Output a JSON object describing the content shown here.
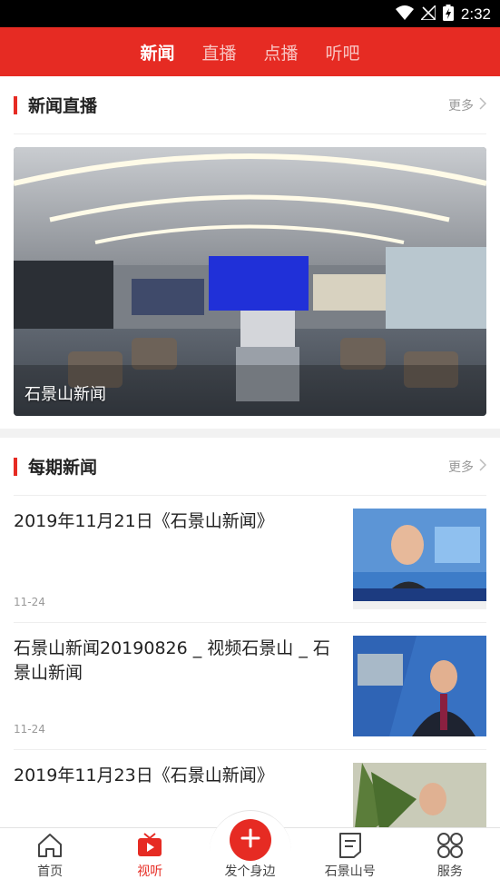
{
  "status_bar": {
    "time": "2:32",
    "icons": [
      "wifi-icon",
      "no-signal-icon",
      "battery-charging-icon"
    ]
  },
  "top_tabs": [
    {
      "label": "新闻",
      "active": true
    },
    {
      "label": "直播",
      "active": false
    },
    {
      "label": "点播",
      "active": false
    },
    {
      "label": "听吧",
      "active": false
    }
  ],
  "live_section": {
    "title": "新闻直播",
    "more_label": "更多",
    "card_caption": "石景山新闻"
  },
  "period_section": {
    "title": "每期新闻",
    "more_label": "更多",
    "items": [
      {
        "title": "2019年11月21日《石景山新闻》",
        "date": "11-24"
      },
      {
        "title": "石景山新闻20190826 _ 视频石景山 _ 石景山新闻",
        "date": "11-24"
      },
      {
        "title": "2019年11月23日《石景山新闻》",
        "date": ""
      }
    ]
  },
  "bottom_nav": [
    {
      "label": "首页",
      "icon": "home-icon",
      "active": false
    },
    {
      "label": "视听",
      "icon": "tv-icon",
      "active": true
    },
    {
      "label": "发个身边",
      "icon": "plus-icon",
      "active": false
    },
    {
      "label": "石景山号",
      "icon": "document-icon",
      "active": false
    },
    {
      "label": "服务",
      "icon": "grid-icon",
      "active": false
    }
  ],
  "colors": {
    "accent": "#e62b23",
    "text": "#222222",
    "muted": "#999999"
  }
}
